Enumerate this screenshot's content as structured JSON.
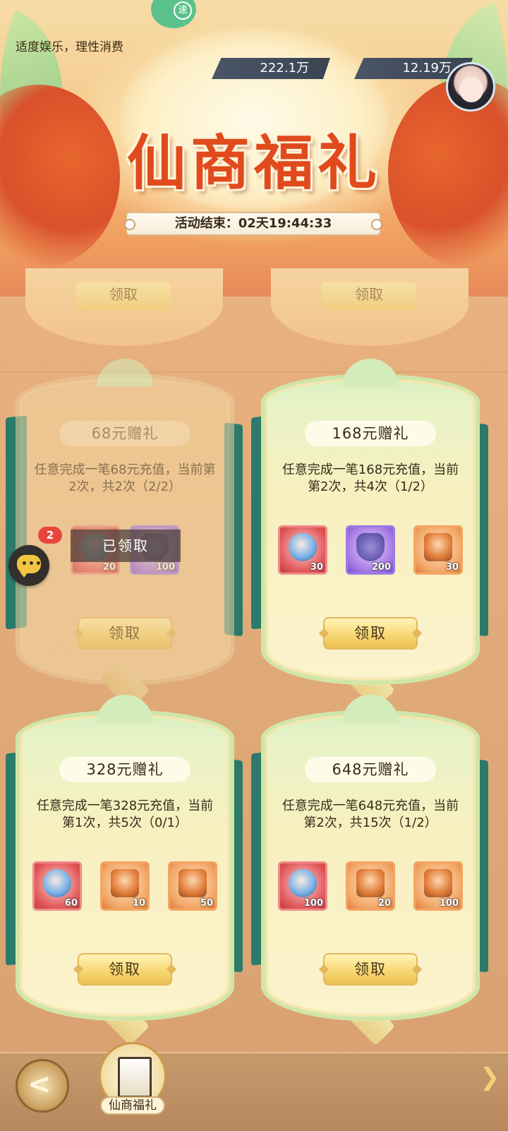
{
  "header": {
    "notice": "适度娱乐，理性消费",
    "speed_label": "速",
    "currency_1": "222.1万",
    "currency_2": "12.19万",
    "title": "仙商福礼",
    "timer": "活动结束：02天19:44:33"
  },
  "partial_cards": [
    {
      "button": "领取"
    },
    {
      "button": "领取"
    }
  ],
  "cards": [
    {
      "title": "68元赠礼",
      "desc": "任意完成一笔68元充值，当前第2次，共2次（2/2）",
      "items": [
        {
          "kind": "red",
          "qty": "20"
        },
        {
          "kind": "purple",
          "qty": "100"
        }
      ],
      "claimed_label": "已领取",
      "button": "领取"
    },
    {
      "title": "168元赠礼",
      "desc": "任意完成一笔168元充值，当前第2次，共4次（1/2）",
      "items": [
        {
          "kind": "red",
          "qty": "30"
        },
        {
          "kind": "purple",
          "qty": "200"
        },
        {
          "kind": "orange",
          "qty": "30"
        }
      ],
      "button": "领取"
    },
    {
      "title": "328元赠礼",
      "desc": "任意完成一笔328元充值，当前第1次，共5次（0/1）",
      "items": [
        {
          "kind": "red",
          "qty": "60"
        },
        {
          "kind": "orange",
          "qty": "10"
        },
        {
          "kind": "orange",
          "qty": "50"
        }
      ],
      "button": "领取"
    },
    {
      "title": "648元赠礼",
      "desc": "任意完成一笔648元充值，当前第2次，共15次（1/2）",
      "items": [
        {
          "kind": "red",
          "qty": "100"
        },
        {
          "kind": "orange",
          "qty": "20"
        },
        {
          "kind": "orange",
          "qty": "100"
        }
      ],
      "button": "领取"
    }
  ],
  "chat": {
    "badge": "2",
    "icon": "chat-bubble-icon"
  },
  "bottom": {
    "tab_label": "仙商福礼",
    "back_icon": "back-arrow-icon",
    "next_icon": "chevron-right-icon"
  },
  "colors": {
    "title_red": "#e04a1c",
    "button_gold": "#f7d874",
    "card_green": "#d6efc1"
  }
}
